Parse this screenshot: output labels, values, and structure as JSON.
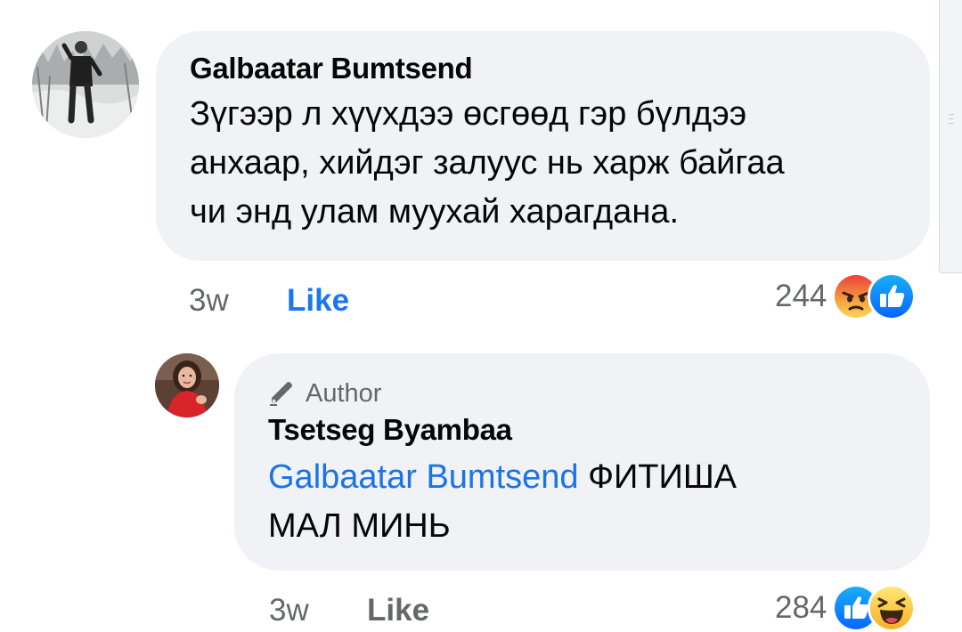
{
  "comment": {
    "author": "Galbaatar Bumtsend",
    "text": "Зүгээр л хүүхдээ өсгөөд гэр бүлдээ анхаар, хийдэг залуус нь харж байгаа чи энд улам муухай харагдана.",
    "text_lines": [
      "Зүгээр л хүүхдээ өсгөөд гэр бүлдээ",
      "анхаар, хийдэг залуус нь харж байгаа",
      "чи энд улам муухай харагдана."
    ],
    "time": "3w",
    "like_label": "Like",
    "like_state": "liked",
    "reaction_count": "244",
    "reaction_icons": [
      "angry-reaction",
      "like-reaction"
    ]
  },
  "reply": {
    "badge": "Author",
    "badge_icon": "pen-icon",
    "author": "Tsetseg Byambaa",
    "mention": "Galbaatar Bumtsend",
    "text_line1": "ФИТИША",
    "text_line2": "МАЛ МИНЬ",
    "time": "3w",
    "like_label": "Like",
    "like_state": "not-liked",
    "reaction_count": "284",
    "reaction_icons": [
      "like-reaction",
      "haha-reaction"
    ]
  },
  "colors": {
    "bubble_bg": "#f0f2f5",
    "link_blue": "#1877f2",
    "mention_blue": "#1b74e4",
    "secondary_text": "#65676b",
    "primary_text": "#050505"
  }
}
